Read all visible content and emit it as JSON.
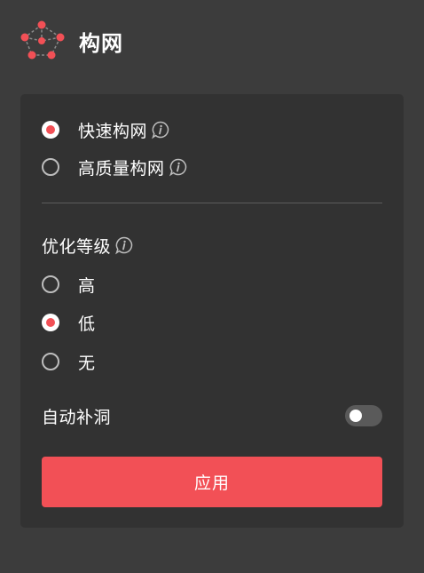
{
  "header": {
    "title": "构网",
    "logo_icon": "mesh-network-icon",
    "accent_color": "#f25056"
  },
  "meshing_mode": {
    "options": [
      {
        "label": "快速构网",
        "selected": true,
        "info_icon": "info-icon"
      },
      {
        "label": "高质量构网",
        "selected": false,
        "info_icon": "info-icon"
      }
    ]
  },
  "optimization": {
    "title": "优化等级",
    "info_icon": "info-icon",
    "options": [
      {
        "label": "高",
        "selected": false
      },
      {
        "label": "低",
        "selected": true
      },
      {
        "label": "无",
        "selected": false
      }
    ]
  },
  "hole_filling": {
    "label": "自动补洞",
    "enabled": false
  },
  "apply_button": {
    "label": "应用"
  },
  "colors": {
    "background": "#3c3c3c",
    "panel": "#323232",
    "accent": "#f25056",
    "toggle_off": "#5a5a5a"
  }
}
